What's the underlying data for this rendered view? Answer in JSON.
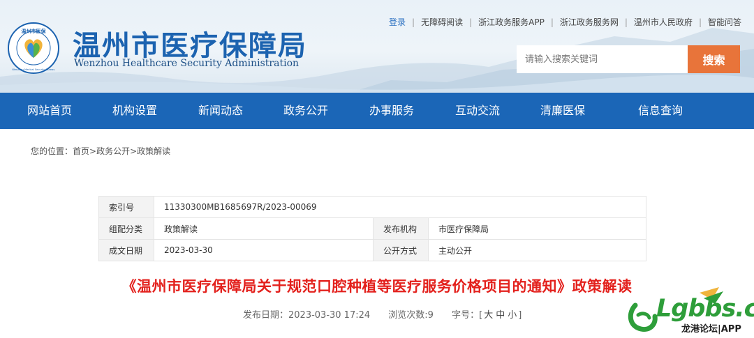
{
  "header": {
    "title": "温州市医疗保障局",
    "subtitle": "Wenzhou Healthcare Security Administration",
    "logo_ring_text": "温州市医保",
    "logo_ring_subtext": "Wenzhou Medical Security Bureau",
    "top_links": [
      "登录",
      "无障碍阅读",
      "浙江政务服务APP",
      "浙江政务服务网",
      "温州市人民政府",
      "智能问答"
    ],
    "search_placeholder": "请输入搜索关键词",
    "search_button": "搜索",
    "colors": {
      "brand_blue": "#1b66b7",
      "search_orange": "#e8743a"
    }
  },
  "nav": {
    "items": [
      "网站首页",
      "机构设置",
      "新闻动态",
      "政务公开",
      "办事服务",
      "互动交流",
      "清廉医保",
      "信息查询"
    ]
  },
  "breadcrumb": {
    "prefix": "您的位置：",
    "items": [
      "首页",
      "政务公开",
      "政策解读"
    ],
    "separator": ">"
  },
  "info": {
    "index_label": "索引号",
    "index_value": "11330300MB1685697R/2023-00069",
    "category_label": "组配分类",
    "category_value": "政策解读",
    "publisher_label": "发布机构",
    "publisher_value": "市医疗保障局",
    "date_label": "成文日期",
    "date_value": "2023-03-30",
    "open_label": "公开方式",
    "open_value": "主动公开"
  },
  "article": {
    "title": "《温州市医疗保障局关于规范口腔种植等医疗服务价格项目的通知》政策解读",
    "publish_date": "发布日期：2023-03-30 17:24",
    "views": "浏览次数:9",
    "font_size_label": "字号：",
    "font_sizes": [
      "大",
      "中",
      "小"
    ],
    "title_color": "#e3211d"
  },
  "watermark": {
    "brand": "Lgbbs.cn",
    "sub": "龙港论坛|APP"
  }
}
